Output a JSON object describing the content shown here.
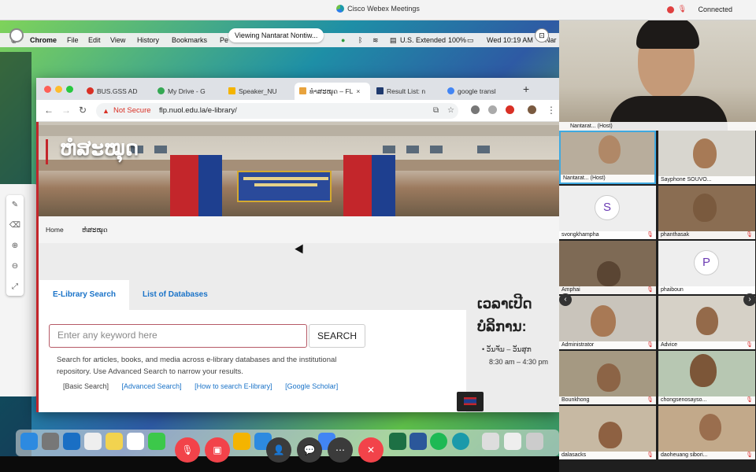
{
  "webex": {
    "title": "Cisco Webex Meetings",
    "status": "Connected",
    "viewing": "Viewing Nantarat Nontiw..."
  },
  "mac_menu": {
    "app": "Chrome",
    "items": [
      "File",
      "Edit",
      "View",
      "History",
      "Bookmarks",
      "Pe"
    ],
    "input_source": "U.S. Extended",
    "battery": "100%",
    "clock": "Wed 10:19 AM",
    "user": "Nar"
  },
  "browser": {
    "tabs": [
      {
        "label": "BUS.GSS AD",
        "color": "#d93025"
      },
      {
        "label": "My Drive - G",
        "color": "#34a853"
      },
      {
        "label": "Speaker_NU",
        "color": "#f4b400"
      },
      {
        "label": "ທໍາສະໝຸດ – FL",
        "color": "#e8a33d"
      },
      {
        "label": "Result List: n",
        "color": "#1f3a6e"
      },
      {
        "label": "google transl",
        "color": "#4285f4"
      }
    ],
    "not_secure": "Not Secure",
    "url": "flp.nuol.edu.la/e-library/"
  },
  "page": {
    "site_title": "ຫໍສະໝຸດ",
    "nav": [
      "Home",
      "ຫໍສະໝຸດ"
    ],
    "tab_search": "E-Library Search",
    "tab_databases": "List of Databases",
    "search_placeholder": "Enter any keyword here",
    "search_button": "SEARCH",
    "search_help": "Search for articles, books, and media across e-library databases and the institutional repository. Use Advanced Search to narrow your results.",
    "links": {
      "basic": "[Basic Search]",
      "advanced": "[Advanced Search]",
      "howto": "[How to search E-library]",
      "scholar": "[Google Scholar]"
    },
    "hours_title_1": "ເວລາເປີດ",
    "hours_title_2": "ບໍລິການ:",
    "hours_days": "ວັນຈັນ – ວັນສຸກ",
    "hours_time": "8:30 am – 4:30 pm"
  },
  "participants": {
    "speaker": "Nantarat... (Host)",
    "tiles": [
      {
        "name": "Nantarat... (Host)"
      },
      {
        "name": "Sayphone SOUVO..."
      },
      {
        "name": "svongkhampha",
        "letter": "S"
      },
      {
        "name": "phanthasak"
      },
      {
        "name": "Amphai"
      },
      {
        "name": "phaiboun",
        "letter": "P"
      },
      {
        "name": "Administrator"
      },
      {
        "name": "Advice"
      },
      {
        "name": "Bounkhong"
      },
      {
        "name": "chongsenosayso..."
      },
      {
        "name": "dalasacks"
      },
      {
        "name": "daoheuang sibori..."
      }
    ]
  }
}
